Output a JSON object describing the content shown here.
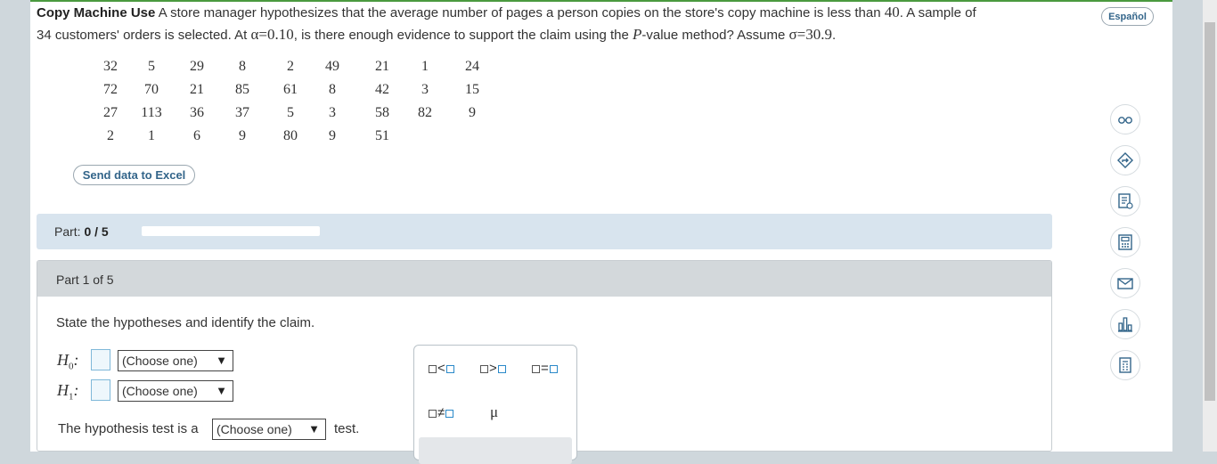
{
  "problem": {
    "title": "Copy Machine Use",
    "text_1": "A store manager hypothesizes that the average number of pages a person copies on the store's copy machine is less than",
    "mu_value": "40",
    "text_2": ". A sample of",
    "n_value": "34",
    "text_3": "customers' orders is selected. At",
    "alpha_sym": "α",
    "eq": "=",
    "alpha_value": "0.10",
    "text_4": ", is there enough evidence to support the claim using the",
    "p_letter": "P",
    "text_5": "-value method? Assume",
    "sigma_sym": "σ",
    "sigma_value": "30.9",
    "text_end": "."
  },
  "data_table": [
    [
      "32",
      "5",
      "29",
      "8",
      "2",
      "49",
      "21",
      "1",
      "24"
    ],
    [
      "72",
      "70",
      "21",
      "85",
      "61",
      "8",
      "42",
      "3",
      "15"
    ],
    [
      "27",
      "113",
      "36",
      "37",
      "5",
      "3",
      "58",
      "82",
      "9"
    ],
    [
      "2",
      "1",
      "6",
      "9",
      "80",
      "9",
      "51",
      "",
      ""
    ]
  ],
  "excel_button": "Send data to Excel",
  "progress": {
    "label": "Part:",
    "value": "0 / 5",
    "fraction": 0
  },
  "part": {
    "header": "Part 1 of 5",
    "instruction": "State the hypotheses and identify the claim.",
    "h0_letter": "H",
    "h0_sub": "0",
    "h1_letter": "H",
    "h1_sub": "1",
    "colon": ":",
    "h0_select": "(Choose one)",
    "h1_select": "(Choose one)",
    "sentence_start": "The hypothesis test is a",
    "test_select": "(Choose one)",
    "sentence_end": "test.",
    "dropdown_arrow": "▼"
  },
  "palette": {
    "lt": "<",
    "gt": ">",
    "eq": "=",
    "ne": "≠",
    "mu": "μ"
  },
  "language_button": "Español",
  "side_tools": [
    "glasses-icon",
    "share-arrow-icon",
    "checklist-icon",
    "calculator-icon",
    "mail-icon",
    "bar-chart-icon",
    "data-table-icon"
  ],
  "colors": {
    "accent": "#33658a",
    "progress_bg": "#d8e4ee",
    "part_header": "#d3d8db",
    "top_line": "#4a9a3f"
  }
}
